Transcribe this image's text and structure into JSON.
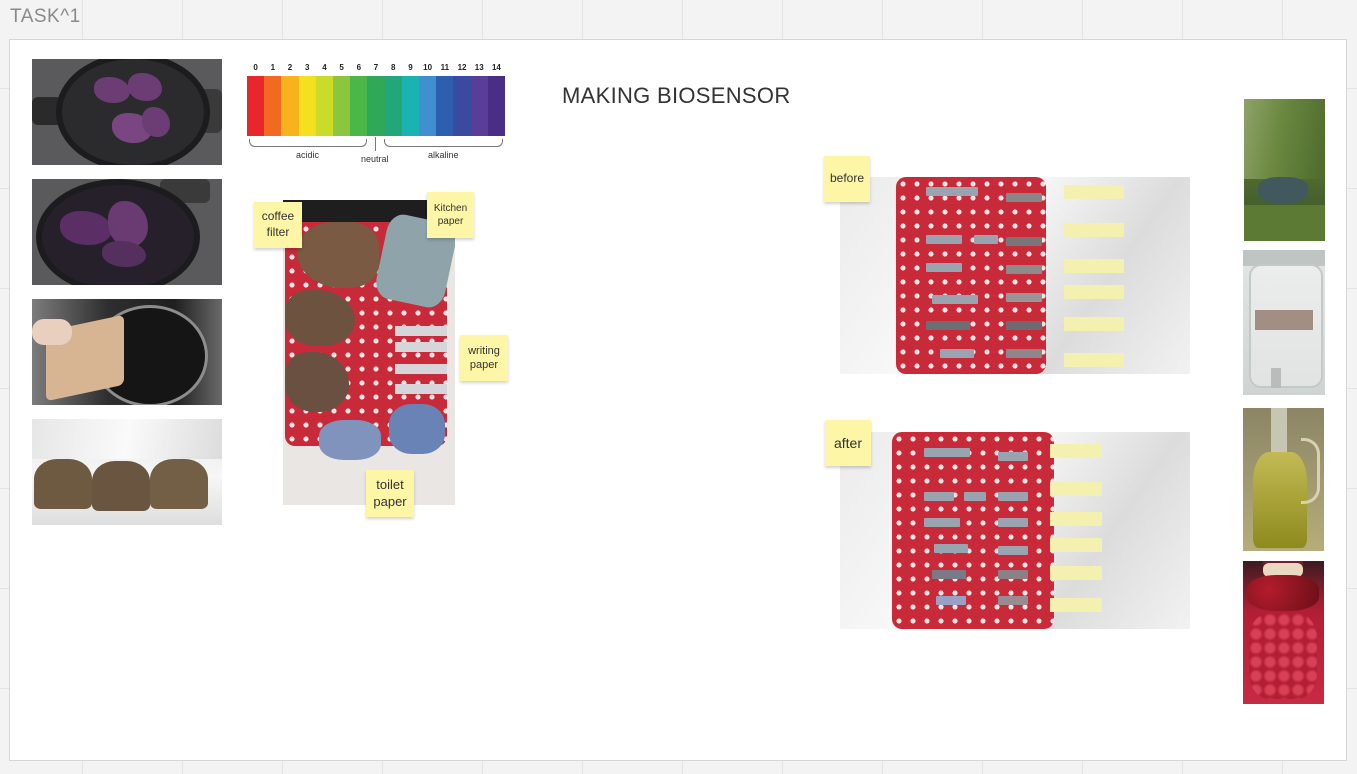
{
  "frame": {
    "title": "TASK^1"
  },
  "board": {
    "heading": "MAKING BIOSENSOR"
  },
  "ph_scale": {
    "numbers": [
      "0",
      "1",
      "2",
      "3",
      "4",
      "5",
      "6",
      "7",
      "8",
      "9",
      "10",
      "11",
      "12",
      "13",
      "14"
    ],
    "colors": [
      "#e8262b",
      "#f26a22",
      "#f8b21b",
      "#f4e01f",
      "#c9dc2a",
      "#8cc63f",
      "#4cb749",
      "#2fa85a",
      "#22a77a",
      "#19b3b1",
      "#3f8fd1",
      "#2e5eb0",
      "#3a4aa0",
      "#5a3d98",
      "#4a2d86"
    ],
    "labels": {
      "acidic": "acidic",
      "neutral": "neutral",
      "alkaline": "alkaline"
    }
  },
  "stickies": {
    "coffee_filter": "coffee filter",
    "kitchen_paper": "Kitchen paper",
    "writing_paper": "writing paper",
    "toilet_paper": "toilet paper",
    "before": "before",
    "after": "after"
  },
  "images": {
    "left": [
      "cabbage-in-pot-icon",
      "cabbage-boiling-icon",
      "filter-dipping-icon",
      "dyed-filters-icon"
    ],
    "center": "paper-samples-tray-icon",
    "right": [
      "pond-garden-icon",
      "water-jar-icon",
      "olive-oil-bottle-icon",
      "pomegranate-juice-bottle-icon"
    ]
  }
}
